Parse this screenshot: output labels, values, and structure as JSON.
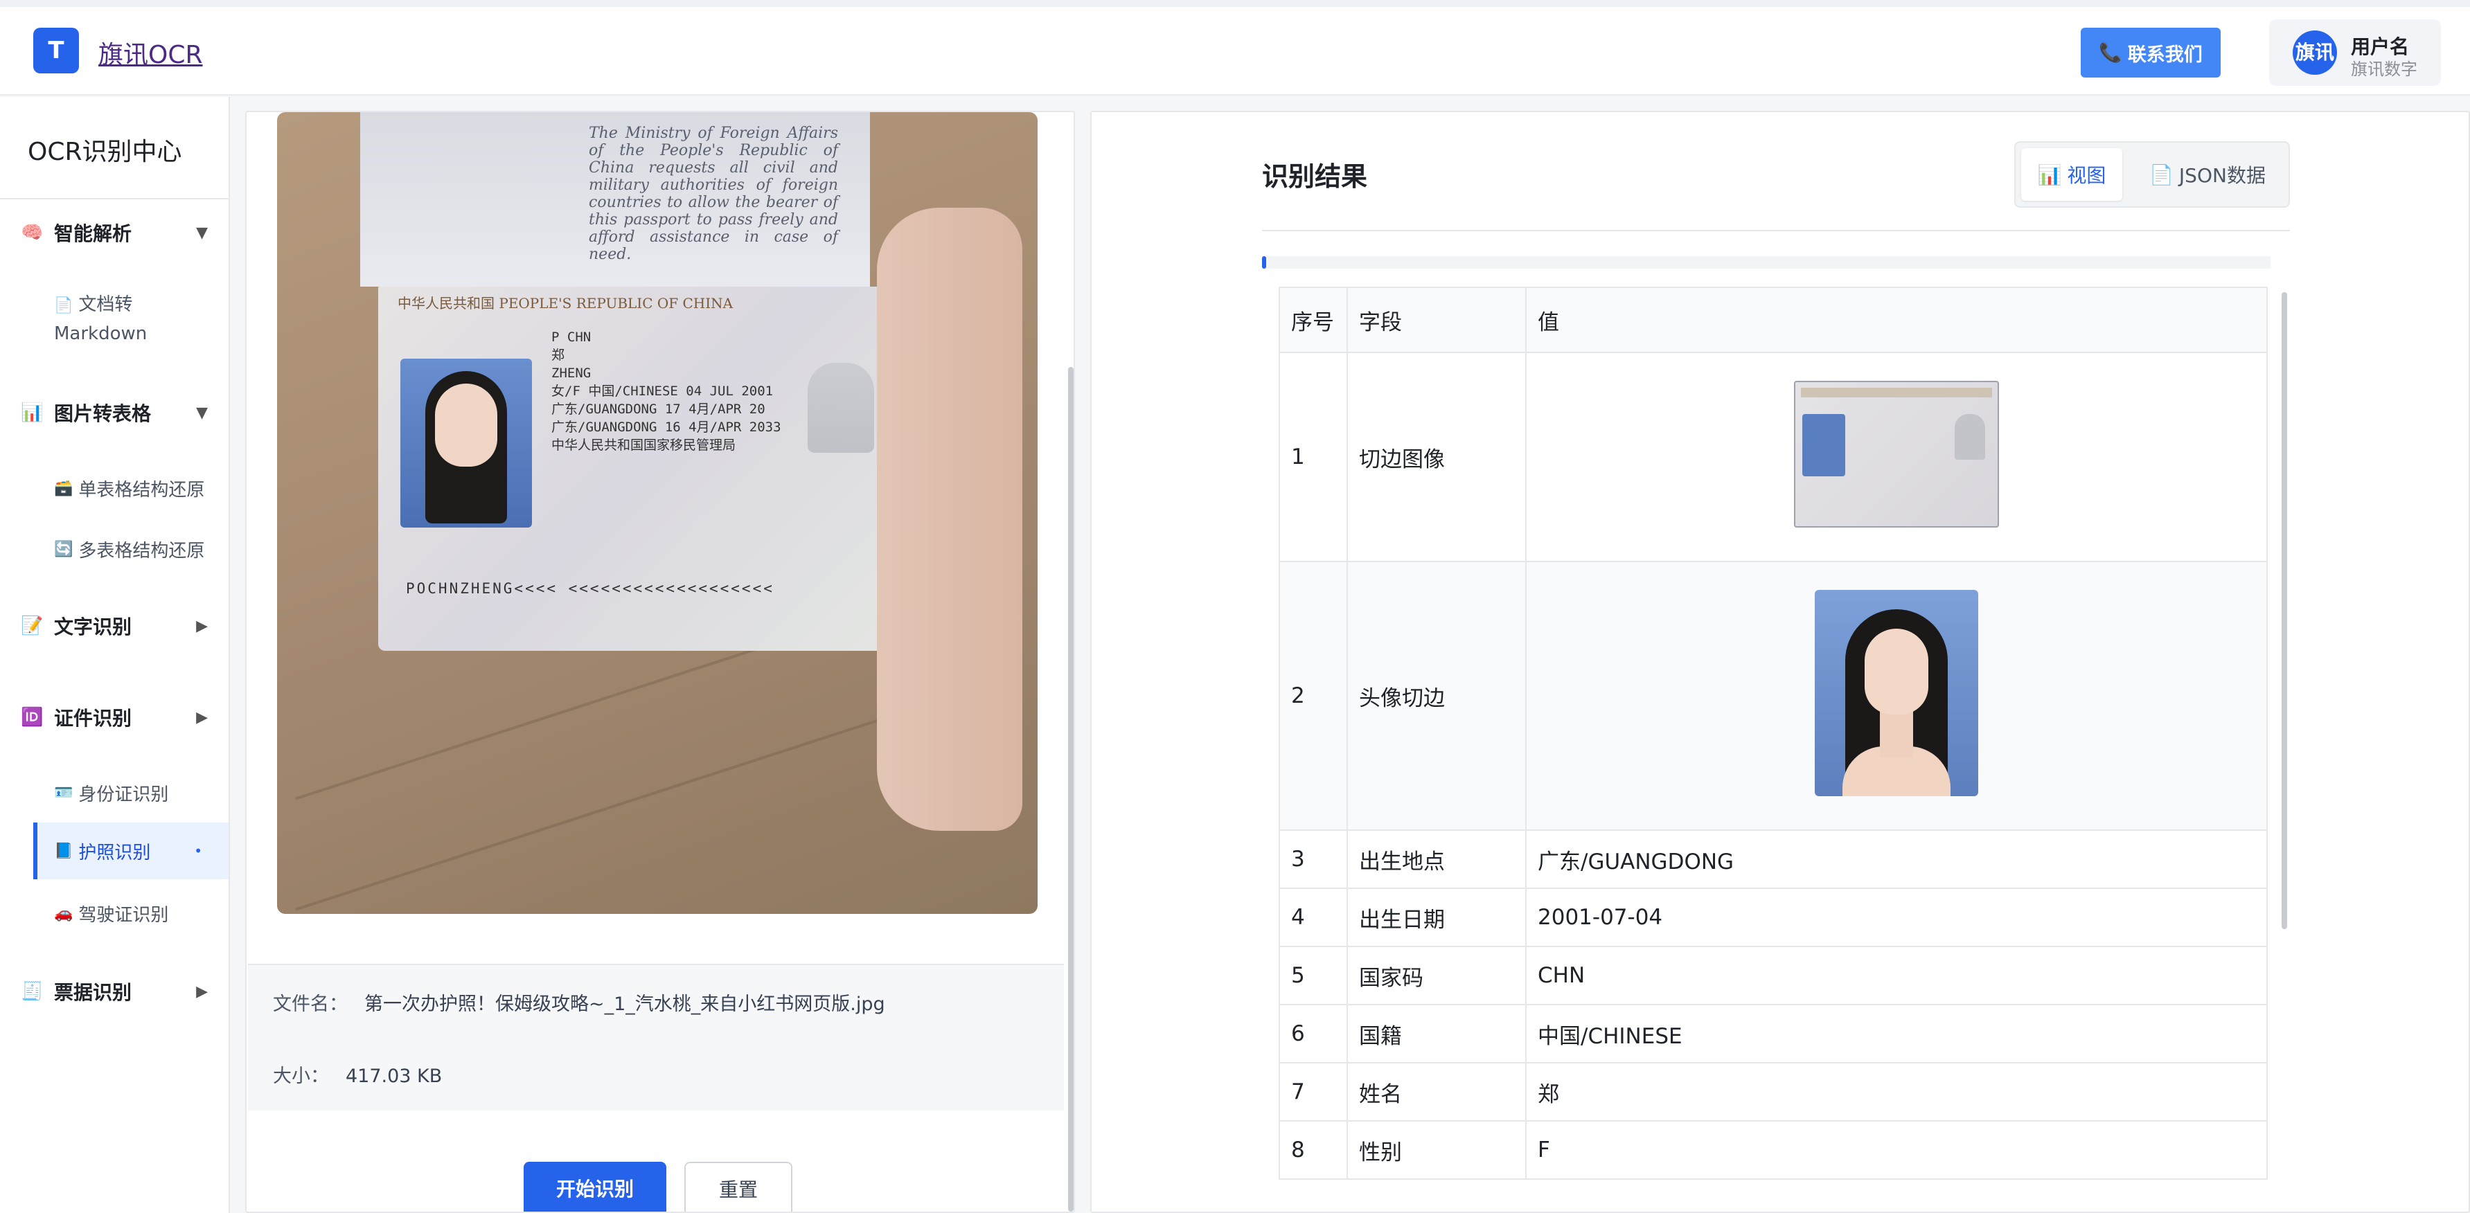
{
  "header": {
    "logo_letter": "T",
    "brand": "旗讯OCR",
    "contact_label": "联系我们",
    "avatar_text": "旗讯",
    "user_name": "用户名",
    "user_org": "旗讯数字"
  },
  "sidebar": {
    "title": "OCR识别中心",
    "groups": [
      {
        "label": "智能解析",
        "icon": "brain-icon",
        "arrow": "▼",
        "items": [
          {
            "label": "文档转 Markdown",
            "icon": "document-icon"
          }
        ]
      },
      {
        "label": "图片转表格",
        "icon": "bar-chart-icon",
        "arrow": "▼",
        "items": [
          {
            "label": "单表格结构还原",
            "icon": "box-icon"
          },
          {
            "label": "多表格结构还原",
            "icon": "refresh-icon"
          }
        ]
      },
      {
        "label": "文字识别",
        "icon": "memo-icon",
        "arrow": "▶",
        "items": []
      },
      {
        "label": "证件识别",
        "icon": "id-icon",
        "arrow": "▶",
        "items": [
          {
            "label": "身份证识别",
            "icon": "id-card-icon"
          },
          {
            "label": "护照识别",
            "icon": "passport-icon",
            "active": true
          },
          {
            "label": "驾驶证识别",
            "icon": "car-icon"
          }
        ]
      },
      {
        "label": "票据识别",
        "icon": "receipt-icon",
        "arrow": "▶",
        "items": []
      }
    ]
  },
  "upload": {
    "passport_text": "The Ministry of Foreign Affairs of the People's Republic of China requests all civil and military authorities of foreign countries to allow the bearer of this passport to pass freely and afford assistance in case of need.",
    "passport_header": "中华人民共和国  PEOPLE'S REPUBLIC OF CHINA",
    "passport_fields": [
      "P      CHN",
      "郑",
      "ZHENG",
      "女/F   中国/CHINESE   04 JUL 2001",
      "广东/GUANGDONG   17 4月/APR 20",
      "广东/GUANGDONG   16 4月/APR 2033",
      "中华人民共和国国家移民管理局"
    ],
    "passport_mrz": "POCHNZHENG<<<<  <<<<<<<<<<<<<<<<<<<",
    "file_name_label": "文件名：",
    "file_name": "第一次办护照！保姆级攻略~_1_汽水桃_来自小红书网页版.jpg",
    "size_label": "大小：",
    "size": "417.03 KB",
    "start_label": "开始识别",
    "reset_label": "重置"
  },
  "result": {
    "title": "识别结果",
    "tab_view": "视图",
    "tab_json": "JSON数据",
    "columns": [
      "序号",
      "字段",
      "值"
    ],
    "rows": [
      {
        "idx": "1",
        "field": "切边图像",
        "value": ""
      },
      {
        "idx": "2",
        "field": "头像切边",
        "value": ""
      },
      {
        "idx": "3",
        "field": "出生地点",
        "value": "广东/GUANGDONG"
      },
      {
        "idx": "4",
        "field": "出生日期",
        "value": "2001-07-04"
      },
      {
        "idx": "5",
        "field": "国家码",
        "value": "CHN"
      },
      {
        "idx": "6",
        "field": "国籍",
        "value": "中国/CHINESE"
      },
      {
        "idx": "7",
        "field": "姓名",
        "value": "郑"
      },
      {
        "idx": "8",
        "field": "性别",
        "value": "F"
      }
    ]
  },
  "colors": {
    "accent": "#2563eb",
    "contact": "#4287f5"
  }
}
